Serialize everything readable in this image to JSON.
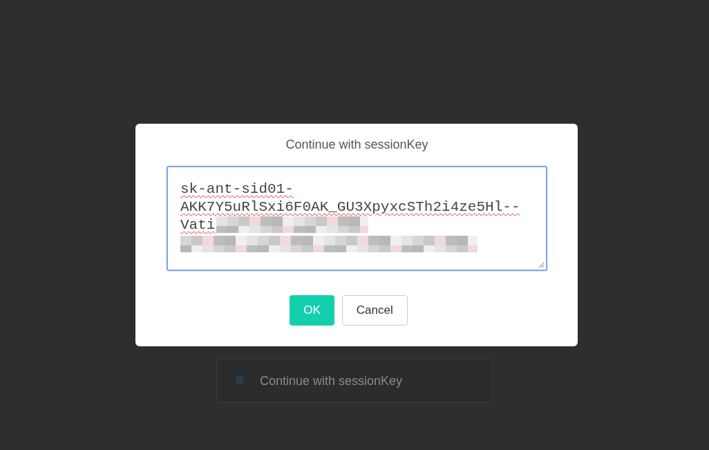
{
  "modal": {
    "title": "Continue with sessionKey",
    "field": {
      "value": "sk-ant-sid01-AKK7Y5uRlSxi6F0AK_GU3XpyxcSTh2i4ze5Hl--Vati",
      "focused": true,
      "redacted": true
    },
    "buttons": [
      {
        "label": "OK",
        "kind": "primary"
      },
      {
        "label": "Cancel",
        "kind": "secondary"
      }
    ]
  },
  "background_button": {
    "label": "Continue with sessionKey"
  }
}
